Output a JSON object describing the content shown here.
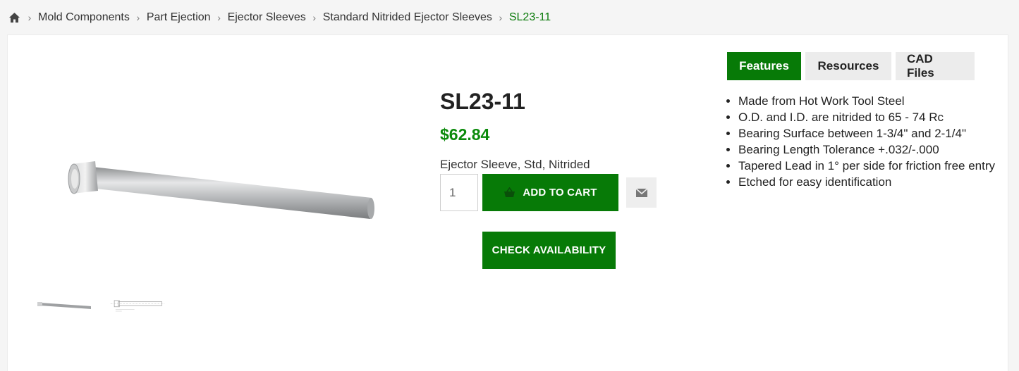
{
  "breadcrumb": {
    "items": [
      "Mold Components",
      "Part Ejection",
      "Ejector Sleeves",
      "Standard Nitrided Ejector Sleeves"
    ],
    "current": "SL23-11"
  },
  "product": {
    "title": "SL23-11",
    "price": "$62.84",
    "description": "Ejector Sleeve, Std, Nitrided",
    "quantity": "1"
  },
  "actions": {
    "add_to_cart": "ADD TO CART",
    "check_availability": "CHECK AVAILABILITY"
  },
  "tabs": [
    {
      "label": "Features",
      "active": true
    },
    {
      "label": "Resources",
      "active": false
    },
    {
      "label": "CAD Files",
      "active": false
    }
  ],
  "features": [
    "Made from Hot Work Tool Steel",
    "O.D. and I.D. are nitrided to 65 - 74 Rc",
    "Bearing Surface between 1-3/4\" and 2-1/4\"",
    "Bearing Length Tolerance +.032/-.000",
    "Tapered Lead in 1° per side for friction free entry",
    "Etched for easy identification"
  ],
  "icons": {
    "home": "home-icon",
    "separator": "chevron-right-icon",
    "cart": "basket-icon",
    "email": "envelope-icon"
  },
  "colors": {
    "accent": "#077a07",
    "price": "#0a8a0a",
    "breadcrumb_current": "#0a7a0a"
  }
}
